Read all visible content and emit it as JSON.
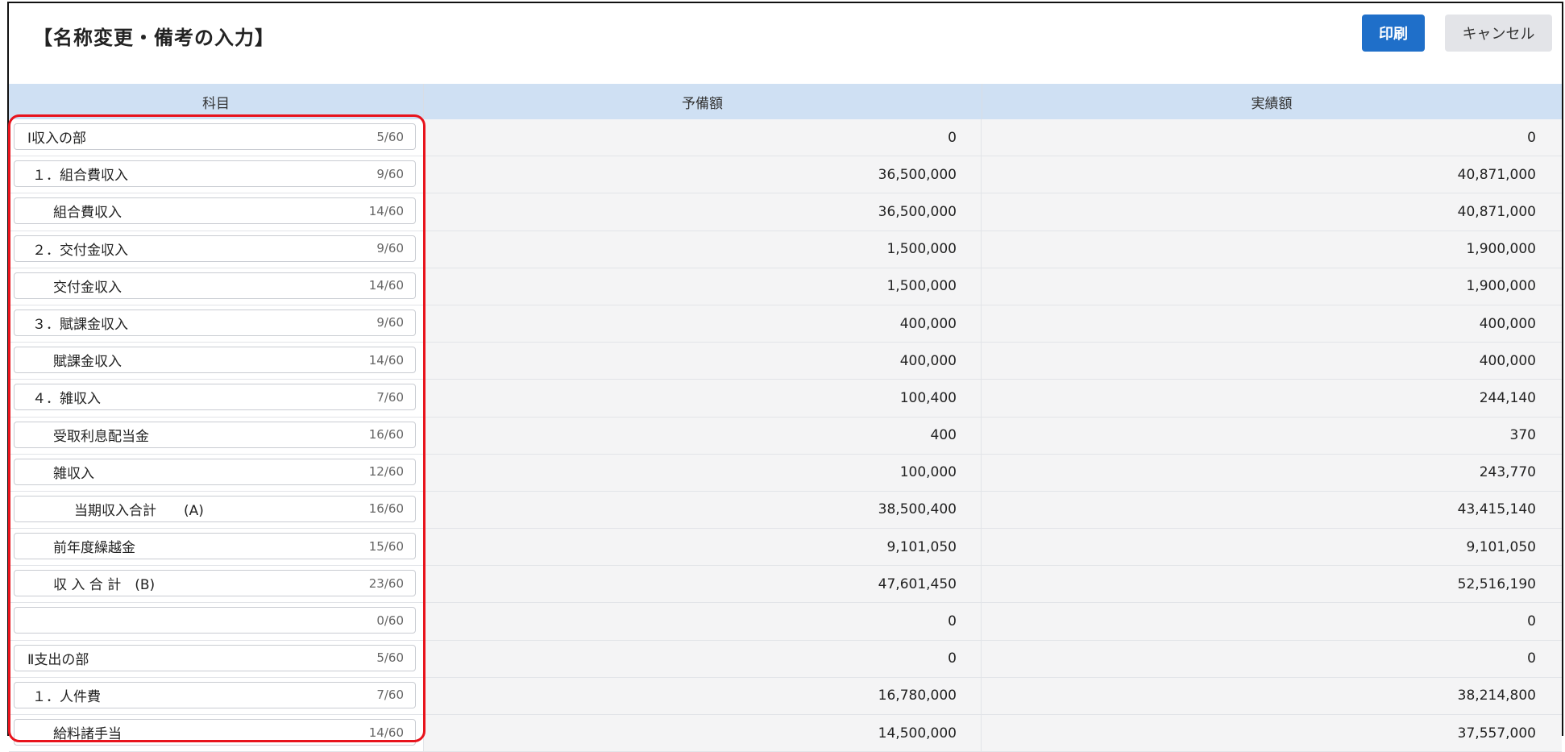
{
  "page": {
    "title": "【名称変更・備考の入力】",
    "print_label": "印刷",
    "cancel_label": "キャンセル"
  },
  "table": {
    "headers": [
      "科目",
      "予備額",
      "実績額"
    ],
    "rows": [
      {
        "name": "Ⅰ収入の部",
        "count": "5/60",
        "budget": "0",
        "actual": "0",
        "indent": 0
      },
      {
        "name": "１．組合費収入",
        "count": "9/60",
        "budget": "36,500,000",
        "actual": "40,871,000",
        "indent": 1
      },
      {
        "name": "組合費収入",
        "count": "14/60",
        "budget": "36,500,000",
        "actual": "40,871,000",
        "indent": 2
      },
      {
        "name": "２．交付金収入",
        "count": "9/60",
        "budget": "1,500,000",
        "actual": "1,900,000",
        "indent": 1
      },
      {
        "name": "交付金収入",
        "count": "14/60",
        "budget": "1,500,000",
        "actual": "1,900,000",
        "indent": 2
      },
      {
        "name": "３．賦課金収入",
        "count": "9/60",
        "budget": "400,000",
        "actual": "400,000",
        "indent": 1
      },
      {
        "name": "賦課金収入",
        "count": "14/60",
        "budget": "400,000",
        "actual": "400,000",
        "indent": 2
      },
      {
        "name": "４．雑収入",
        "count": "7/60",
        "budget": "100,400",
        "actual": "244,140",
        "indent": 1
      },
      {
        "name": "受取利息配当金",
        "count": "16/60",
        "budget": "400",
        "actual": "370",
        "indent": 2
      },
      {
        "name": "雑収入",
        "count": "12/60",
        "budget": "100,000",
        "actual": "243,770",
        "indent": 2
      },
      {
        "name": "当期収入合計　　(A)",
        "count": "16/60",
        "budget": "38,500,400",
        "actual": "43,415,140",
        "indent": 3
      },
      {
        "name": "前年度繰越金",
        "count": "15/60",
        "budget": "9,101,050",
        "actual": "9,101,050",
        "indent": 2
      },
      {
        "name": "収 入 合 計　(B)",
        "count": "23/60",
        "budget": "47,601,450",
        "actual": "52,516,190",
        "indent": 2
      },
      {
        "name": "",
        "count": "0/60",
        "budget": "0",
        "actual": "0",
        "indent": 0
      },
      {
        "name": "Ⅱ支出の部",
        "count": "5/60",
        "budget": "0",
        "actual": "0",
        "indent": 0
      },
      {
        "name": "１．人件費",
        "count": "7/60",
        "budget": "16,780,000",
        "actual": "38,214,800",
        "indent": 1
      },
      {
        "name": "給料諸手当",
        "count": "14/60",
        "budget": "14,500,000",
        "actual": "37,557,000",
        "indent": 2
      }
    ]
  },
  "colors": {
    "header_bg": "#cfe0f3",
    "print_button": "#1f6fc9",
    "cancel_button": "#e3e4e8",
    "highlight_border": "#e8131c"
  }
}
